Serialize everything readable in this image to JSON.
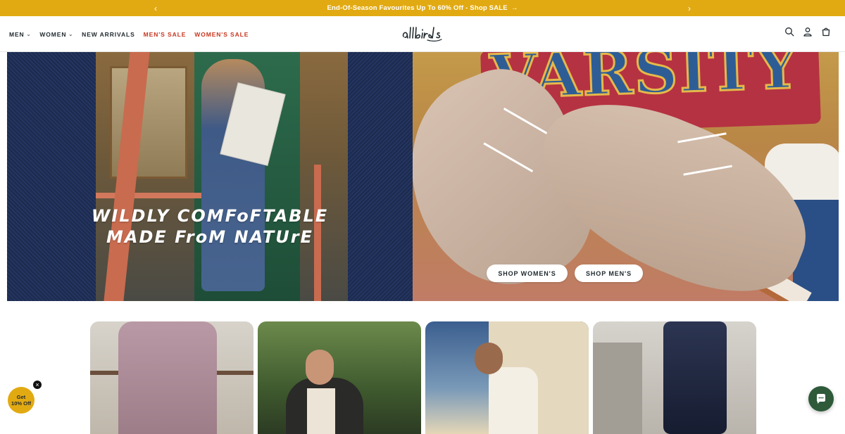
{
  "announcement": {
    "message": "End-Of-Season Favourites Up To 60% Off - Shop SALE",
    "arrow": "→",
    "prev_icon": "chevron-left-icon",
    "next_icon": "chevron-right-icon",
    "color": "#e2aa12"
  },
  "nav": {
    "items": [
      {
        "label": "MEN",
        "dropdown": true
      },
      {
        "label": "WOMEN",
        "dropdown": true
      },
      {
        "label": "NEW ARRIVALS",
        "dropdown": false
      },
      {
        "label": "MEN'S SALE",
        "dropdown": false
      },
      {
        "label": "WOMEN'S SALE",
        "dropdown": false
      }
    ],
    "sale_color": "#c8361f"
  },
  "header": {
    "logo": "allbirds",
    "icons": [
      "search-icon",
      "account-icon",
      "cart-icon"
    ]
  },
  "hero": {
    "headline_line1": "WILDLY COMFoFTABLE",
    "headline_line2": "MADE FroM NATUrE",
    "patch_text": "VARSITY",
    "cta_women": "SHOP WOMEN'S",
    "cta_men": "SHOP MEN'S"
  },
  "promo": {
    "line1": "Get",
    "line2": "10% Off",
    "close": "×"
  },
  "chat": {
    "icon": "chat-icon"
  }
}
